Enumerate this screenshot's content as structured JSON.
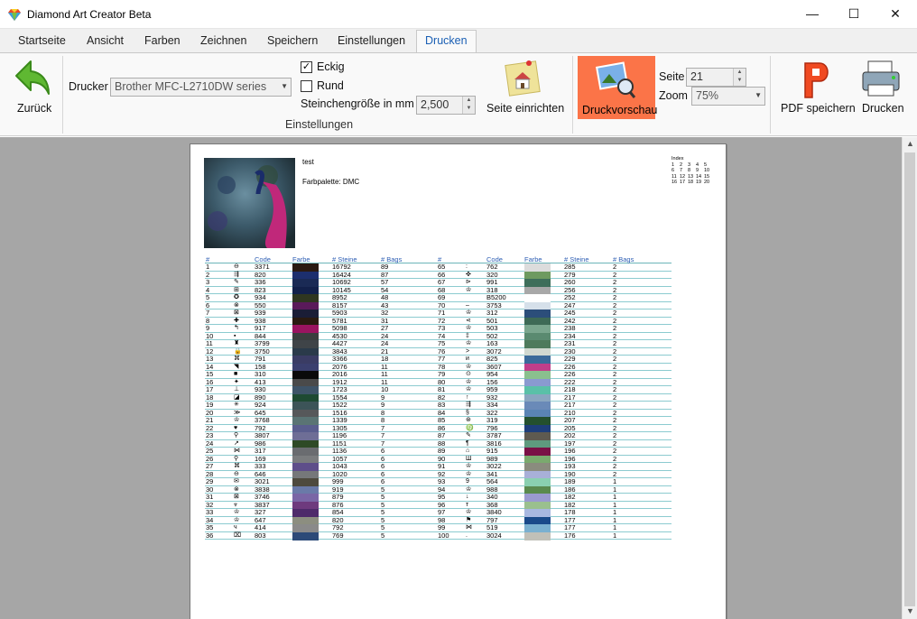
{
  "window": {
    "title": "Diamond Art Creator Beta",
    "minimize": "—",
    "maximize": "☐",
    "close": "✕"
  },
  "tabs": [
    {
      "label": "Startseite"
    },
    {
      "label": "Ansicht"
    },
    {
      "label": "Farben"
    },
    {
      "label": "Zeichnen"
    },
    {
      "label": "Speichern"
    },
    {
      "label": "Einstellungen"
    },
    {
      "label": "Drucken",
      "active": true
    }
  ],
  "ribbon": {
    "back_label": "Zurück",
    "printer_label": "Drucker",
    "printer_value": "Brother MFC-L2710DW series",
    "eckig_label": "Eckig",
    "eckig_checked": true,
    "rund_label": "Rund",
    "rund_checked": false,
    "stone_size_label": "Steinchengröße in mm",
    "stone_size_value": "2,500",
    "group_label": "Einstellungen",
    "page_setup_label": "Seite einrichten",
    "preview_label": "Druckvorschau",
    "page_label": "Seite",
    "page_value": "21",
    "zoom_label": "Zoom",
    "zoom_value": "75%",
    "pdf_label": "PDF speichern",
    "print_label": "Drucken"
  },
  "page": {
    "title": "test",
    "palette": "Farbpalette: DMC",
    "index_label": "Index",
    "index_numbers": [
      "1",
      "2",
      "3",
      "4",
      "5",
      "6",
      "7",
      "8",
      "9",
      "10",
      "11",
      "12",
      "13",
      "14",
      "15",
      "16",
      "17",
      "18",
      "19",
      "20"
    ],
    "headers": {
      "num": "#",
      "code": "Code",
      "farbe": "Farbe",
      "steine": "# Steine",
      "bags": "# Bags"
    }
  },
  "left_rows": [
    [
      "1",
      "⊖",
      "3371",
      "#2a1a12",
      "16792",
      "89"
    ],
    [
      "2",
      "⇶",
      "820",
      "#1c2f6e",
      "16424",
      "87"
    ],
    [
      "3",
      "✎",
      "336",
      "#1a2a55",
      "10692",
      "57"
    ],
    [
      "4",
      "⊞",
      "823",
      "#12204a",
      "10145",
      "54"
    ],
    [
      "5",
      "✪",
      "934",
      "#2f3620",
      "8952",
      "48"
    ],
    [
      "6",
      "⊗",
      "550",
      "#5a1a5a",
      "8157",
      "43"
    ],
    [
      "7",
      "⊠",
      "939",
      "#1a1d36",
      "5903",
      "32"
    ],
    [
      "8",
      "✚",
      "938",
      "#2a1a10",
      "5781",
      "31"
    ],
    [
      "9",
      "↰",
      "917",
      "#9a1460",
      "5098",
      "27"
    ],
    [
      "10",
      "▪",
      "844",
      "#3a3e3e",
      "4530",
      "24"
    ],
    [
      "11",
      "♜",
      "3799",
      "#3f4448",
      "4427",
      "24"
    ],
    [
      "12",
      "🔒",
      "3750",
      "#2a3a4a",
      "3843",
      "21"
    ],
    [
      "13",
      "⌘",
      "791",
      "#3a3c64",
      "3366",
      "18"
    ],
    [
      "14",
      "◥",
      "158",
      "#3a3f6e",
      "2076",
      "11"
    ],
    [
      "15",
      "■",
      "310",
      "#0a0a0a",
      "2016",
      "11"
    ],
    [
      "16",
      "✦",
      "413",
      "#4a4a4a",
      "1912",
      "11"
    ],
    [
      "17",
      "⊥",
      "930",
      "#3e5468",
      "1723",
      "10"
    ],
    [
      "18",
      "◪",
      "890",
      "#1e4a32",
      "1554",
      "9"
    ],
    [
      "19",
      "✳",
      "924",
      "#3c5458",
      "1522",
      "9"
    ],
    [
      "20",
      "≫",
      "645",
      "#56585a",
      "1516",
      "8"
    ],
    [
      "21",
      "♔",
      "3768",
      "#5a7474",
      "1339",
      "8"
    ],
    [
      "22",
      "♥",
      "792",
      "#5a5e8e",
      "1305",
      "7"
    ],
    [
      "23",
      "⚲",
      "3807",
      "#6e6e96",
      "1196",
      "7"
    ],
    [
      "24",
      "↗",
      "986",
      "#2e4a26",
      "1151",
      "7"
    ],
    [
      "25",
      "⋈",
      "317",
      "#6a6c70",
      "1136",
      "6"
    ],
    [
      "26",
      "⚲",
      "169",
      "#7a7c7e",
      "1057",
      "6"
    ],
    [
      "27",
      "⌘",
      "333",
      "#5e4e8a",
      "1043",
      "6"
    ],
    [
      "28",
      "⊖",
      "646",
      "#76787a",
      "1020",
      "6"
    ],
    [
      "29",
      "✉",
      "3021",
      "#4e4a3e",
      "999",
      "6"
    ],
    [
      "30",
      "⊗",
      "3838",
      "#6a7aa8",
      "919",
      "5"
    ],
    [
      "31",
      "⊠",
      "3746",
      "#7a66a6",
      "879",
      "5"
    ],
    [
      "32",
      "⩔",
      "3837",
      "#6e3a7e",
      "876",
      "5"
    ],
    [
      "33",
      "♔",
      "327",
      "#4e2a6a",
      "854",
      "5"
    ],
    [
      "34",
      "♔",
      "647",
      "#8c8e80",
      "820",
      "5"
    ],
    [
      "35",
      "ч",
      "414",
      "#8a8a8a",
      "792",
      "5"
    ],
    [
      "36",
      "⌧",
      "803",
      "#2c4a78",
      "769",
      "5"
    ]
  ],
  "right_rows": [
    [
      "65",
      ":",
      "762",
      "#dcdcdc",
      "285",
      "2"
    ],
    [
      "66",
      "✜",
      "320",
      "#6e9a60",
      "279",
      "2"
    ],
    [
      "67",
      "⊳",
      "991",
      "#3e6e5a",
      "260",
      "2"
    ],
    [
      "68",
      "♔",
      "318",
      "#a8a8a8",
      "256",
      "2"
    ],
    [
      "69",
      "",
      "B5200",
      "#ffffff",
      "252",
      "2"
    ],
    [
      "70",
      "–",
      "3753",
      "#d6e0ea",
      "247",
      "2"
    ],
    [
      "71",
      "♔",
      "312",
      "#2c4e7a",
      "245",
      "2"
    ],
    [
      "72",
      "⋖",
      "501",
      "#3e6a56",
      "242",
      "2"
    ],
    [
      "73",
      "♔",
      "503",
      "#7aa68e",
      "238",
      "2"
    ],
    [
      "74",
      "‡",
      "502",
      "#5a8a70",
      "234",
      "2"
    ],
    [
      "75",
      "♔",
      "163",
      "#4e7a5c",
      "231",
      "2"
    ],
    [
      "76",
      ">",
      "3072",
      "#d0d8d0",
      "230",
      "2"
    ],
    [
      "77",
      "и",
      "825",
      "#3a6a9a",
      "229",
      "2"
    ],
    [
      "78",
      "♔",
      "3607",
      "#c03e8a",
      "226",
      "2"
    ],
    [
      "79",
      "⊙",
      "954",
      "#8ac08e",
      "226",
      "2"
    ],
    [
      "80",
      "♔",
      "156",
      "#8a9ad0",
      "222",
      "2"
    ],
    [
      "81",
      "♔",
      "959",
      "#5ac0a8",
      "218",
      "2"
    ],
    [
      "82",
      "↑",
      "932",
      "#8aa6c0",
      "217",
      "2"
    ],
    [
      "83",
      "⇶",
      "334",
      "#6a8ab8",
      "217",
      "2"
    ],
    [
      "84",
      "§",
      "322",
      "#5a84b4",
      "210",
      "2"
    ],
    [
      "85",
      "⊛",
      "319",
      "#24502e",
      "207",
      "2"
    ],
    [
      "86",
      "♍",
      "796",
      "#1e3e7a",
      "205",
      "2"
    ],
    [
      "87",
      "✎",
      "3787",
      "#5e5a50",
      "202",
      "2"
    ],
    [
      "88",
      "¶",
      "3816",
      "#5e9a7e",
      "197",
      "2"
    ],
    [
      "89",
      "⌂",
      "915",
      "#7a1046",
      "196",
      "2"
    ],
    [
      "90",
      "Ш",
      "989",
      "#7aaa6e",
      "196",
      "2"
    ],
    [
      "91",
      "♔",
      "3022",
      "#8a8c7e",
      "193",
      "2"
    ],
    [
      "92",
      "♔",
      "341",
      "#a8b0d8",
      "190",
      "2"
    ],
    [
      "93",
      "9",
      "564",
      "#8ad0b0",
      "189",
      "1"
    ],
    [
      "94",
      "♔",
      "988",
      "#5a8a4e",
      "186",
      "1"
    ],
    [
      "95",
      "↓",
      "340",
      "#9a9ad0",
      "182",
      "1"
    ],
    [
      "96",
      "т",
      "368",
      "#9ac08e",
      "182",
      "1"
    ],
    [
      "97",
      "♔",
      "3840",
      "#a8b8e0",
      "178",
      "1"
    ],
    [
      "98",
      "⚑",
      "797",
      "#1a4a8a",
      "177",
      "1"
    ],
    [
      "99",
      "⋈",
      "519",
      "#7ab0d0",
      "177",
      "1"
    ],
    [
      "100",
      ".",
      "3024",
      "#c0c0b8",
      "176",
      "1"
    ]
  ]
}
